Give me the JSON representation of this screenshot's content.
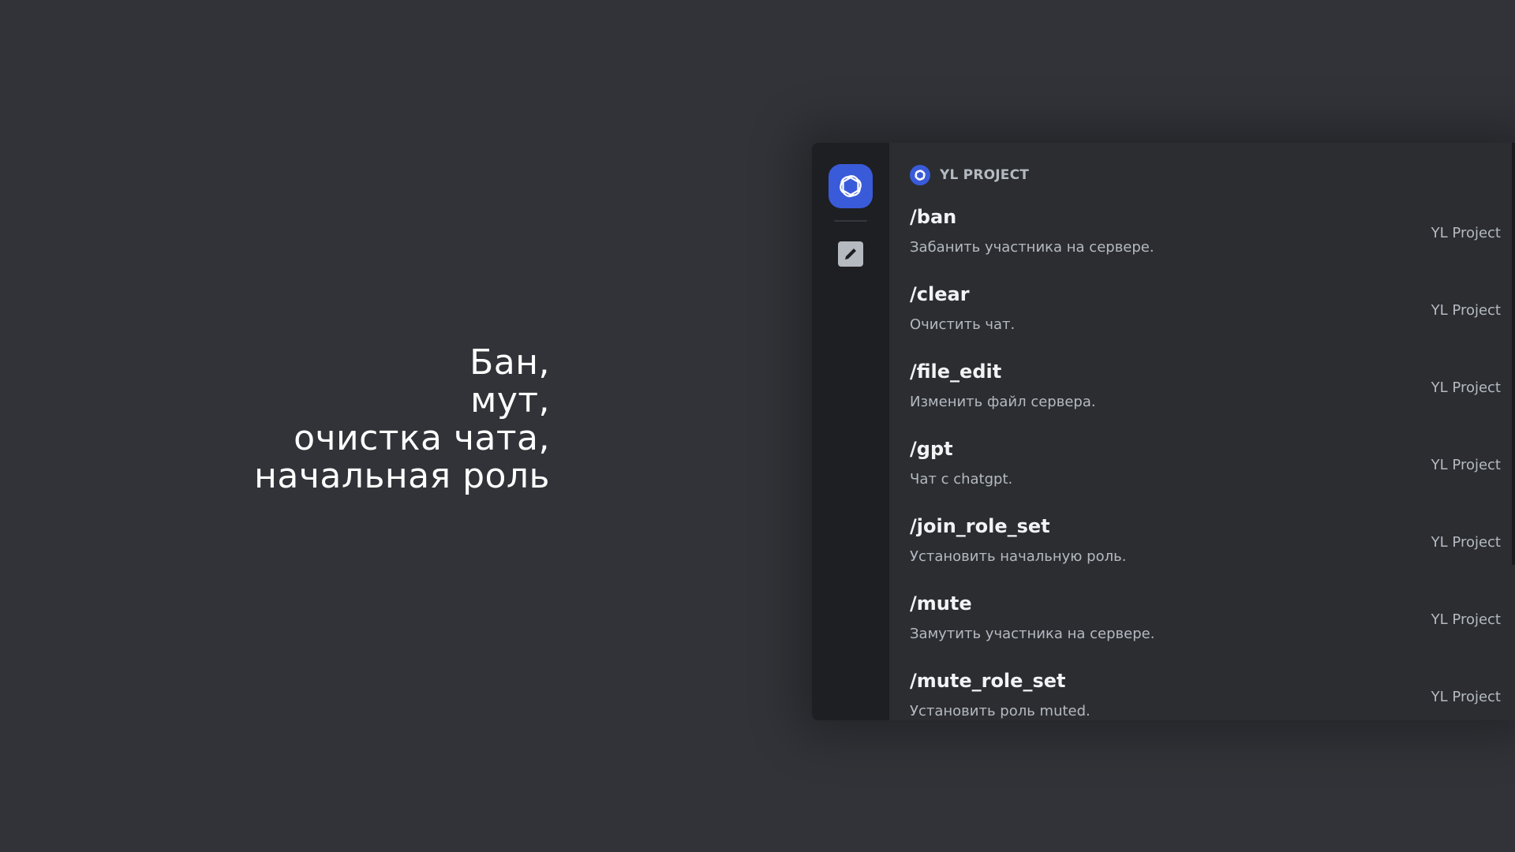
{
  "caption": {
    "lines": [
      "Бан,",
      "мут,",
      "очистка чата,",
      "начальная роль"
    ]
  },
  "rail": {
    "app_icon": "chatgpt-logo-icon",
    "edit_icon": "pencil-icon"
  },
  "section": {
    "title": "YL PROJECT",
    "icon": "chatgpt-logo-icon"
  },
  "commands": [
    {
      "name": "/ban",
      "description": "Забанить участника на сервере.",
      "source": "YL Project"
    },
    {
      "name": "/clear",
      "description": "Очистить чат.",
      "source": "YL Project"
    },
    {
      "name": "/file_edit",
      "description": "Изменить файл сервера.",
      "source": "YL Project"
    },
    {
      "name": "/gpt",
      "description": "Чат с chatgpt.",
      "source": "YL Project"
    },
    {
      "name": "/join_role_set",
      "description": "Установить начальную роль.",
      "source": "YL Project"
    },
    {
      "name": "/mute",
      "description": "Замутить участника на сервере.",
      "source": "YL Project"
    },
    {
      "name": "/mute_role_set",
      "description": "Установить роль muted.",
      "source": "YL Project"
    }
  ],
  "colors": {
    "background": "#313338",
    "popup": "#2b2d31",
    "rail": "#1e1f22",
    "accent": "#3a5bd9"
  }
}
